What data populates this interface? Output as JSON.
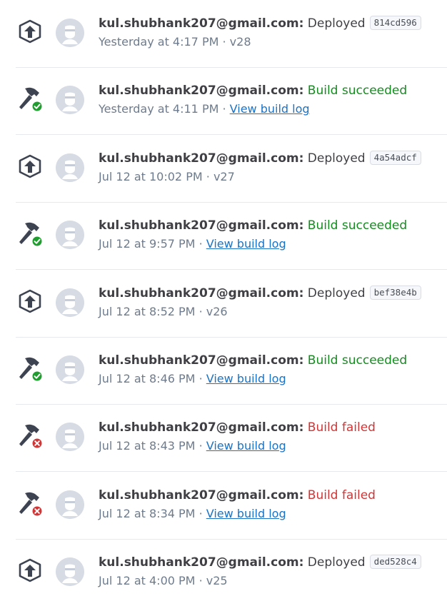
{
  "activity": [
    {
      "kind": "deploy",
      "icon": "deploy-icon",
      "user": "kul.shubhank207@gmail.com:",
      "status": "Deployed",
      "status_tone": "neutral",
      "commit": "814cd596",
      "time": "Yesterday at 4:17 PM",
      "separator": "·",
      "version": "v28"
    },
    {
      "kind": "build",
      "icon": "hammer-success-icon",
      "user": "kul.shubhank207@gmail.com:",
      "status": "Build succeeded",
      "status_tone": "success",
      "time": "Yesterday at 4:11 PM",
      "separator": "·",
      "link": "View build log"
    },
    {
      "kind": "deploy",
      "icon": "deploy-icon",
      "user": "kul.shubhank207@gmail.com:",
      "status": "Deployed",
      "status_tone": "neutral",
      "commit": "4a54adcf",
      "time": "Jul 12 at 10:02 PM",
      "separator": "·",
      "version": "v27"
    },
    {
      "kind": "build",
      "icon": "hammer-success-icon",
      "user": "kul.shubhank207@gmail.com:",
      "status": "Build succeeded",
      "status_tone": "success",
      "time": "Jul 12 at 9:57 PM",
      "separator": "·",
      "link": "View build log"
    },
    {
      "kind": "deploy",
      "icon": "deploy-icon",
      "user": "kul.shubhank207@gmail.com:",
      "status": "Deployed",
      "status_tone": "neutral",
      "commit": "bef38e4b",
      "time": "Jul 12 at 8:52 PM",
      "separator": "·",
      "version": "v26"
    },
    {
      "kind": "build",
      "icon": "hammer-success-icon",
      "user": "kul.shubhank207@gmail.com:",
      "status": "Build succeeded",
      "status_tone": "success",
      "time": "Jul 12 at 8:46 PM",
      "separator": "·",
      "link": "View build log"
    },
    {
      "kind": "build",
      "icon": "hammer-failed-icon",
      "user": "kul.shubhank207@gmail.com:",
      "status": "Build failed",
      "status_tone": "failed",
      "time": "Jul 12 at 8:43 PM",
      "separator": "·",
      "link": "View build log"
    },
    {
      "kind": "build",
      "icon": "hammer-failed-icon",
      "user": "kul.shubhank207@gmail.com:",
      "status": "Build failed",
      "status_tone": "failed",
      "time": "Jul 12 at 8:34 PM",
      "separator": "·",
      "link": "View build log"
    },
    {
      "kind": "deploy",
      "icon": "deploy-icon",
      "user": "kul.shubhank207@gmail.com:",
      "status": "Deployed",
      "status_tone": "neutral",
      "commit": "ded528c4",
      "time": "Jul 12 at 4:00 PM",
      "separator": "·",
      "version": "v25"
    }
  ],
  "colors": {
    "success": "#148d1f",
    "failed": "#d23535",
    "link": "#1a73c6",
    "icon": "#3d4350",
    "avatar_bg": "#d6dbe4"
  }
}
